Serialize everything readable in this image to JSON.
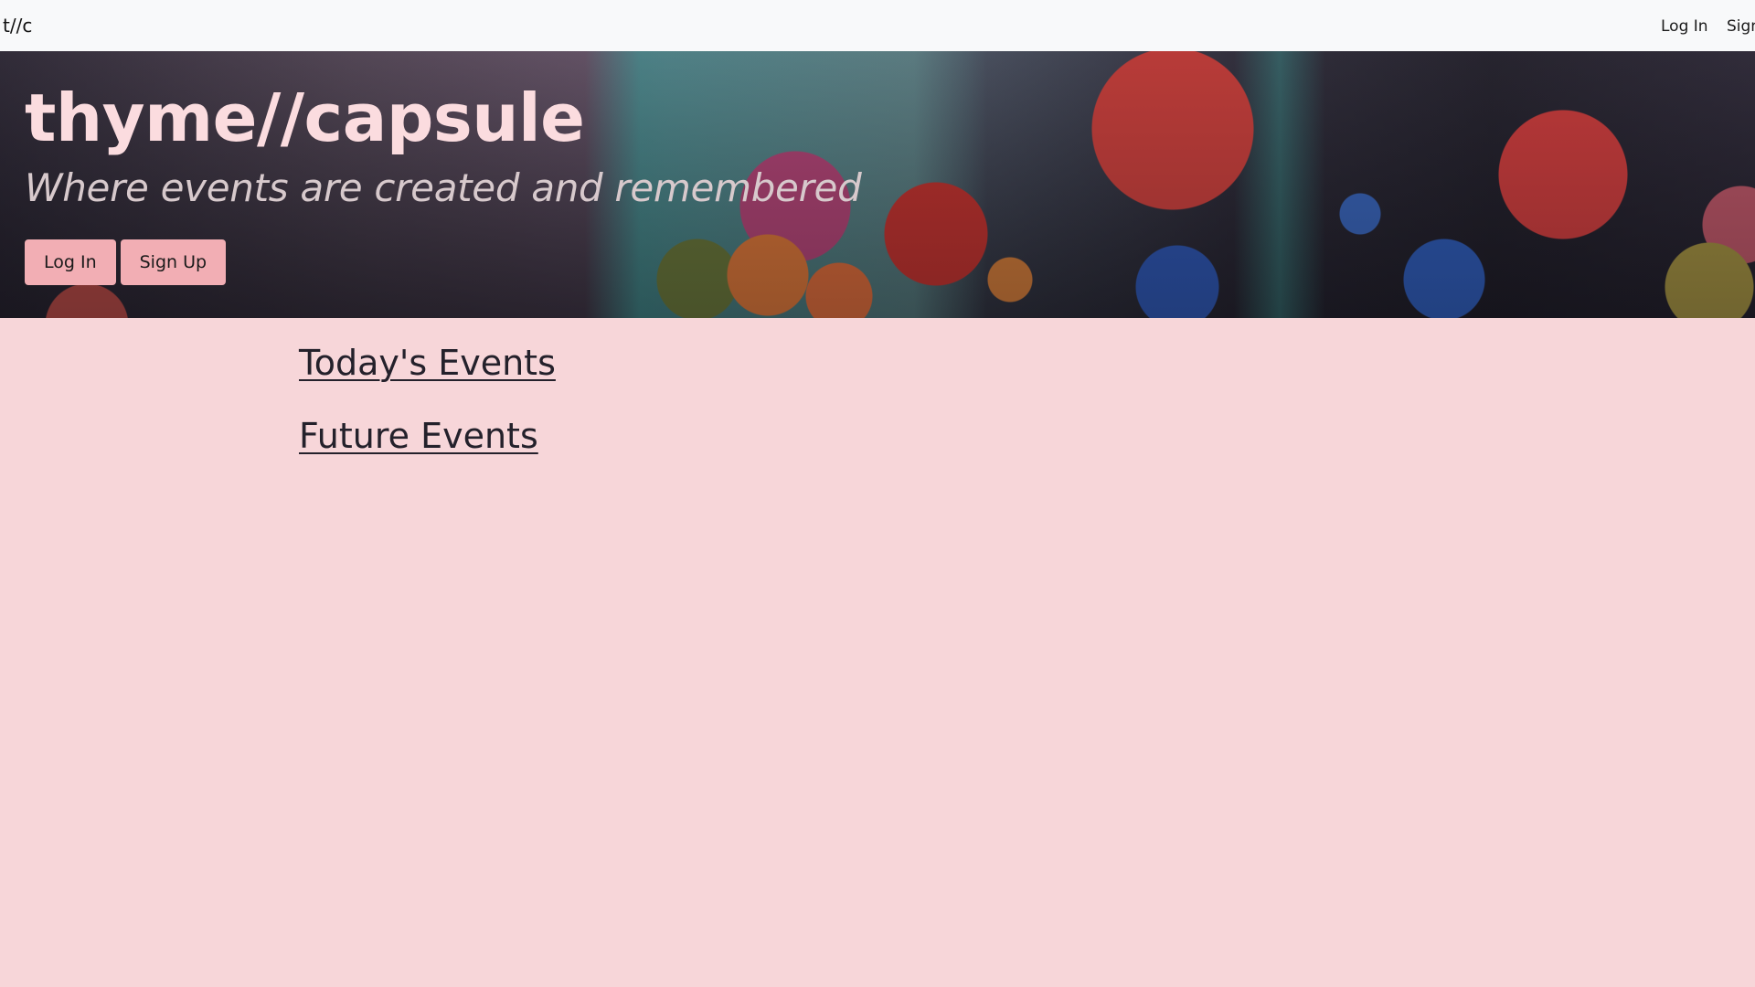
{
  "navbar": {
    "brand": "t//c",
    "links": [
      "Log In",
      "Sign Up"
    ]
  },
  "hero": {
    "title": "thyme//capsule",
    "subtitle": "Where events are created and remembered",
    "buttons": [
      "Log In",
      "Sign Up"
    ],
    "background_image": "concert-balloons-photo"
  },
  "main": {
    "sections": [
      "Today's Events",
      "Future Events"
    ]
  },
  "colors": {
    "page_background": "#f7d6d9",
    "navbar_background": "#f8f9fa",
    "button_background": "#f2aeb4",
    "hero_title": "#fbdcdf"
  }
}
